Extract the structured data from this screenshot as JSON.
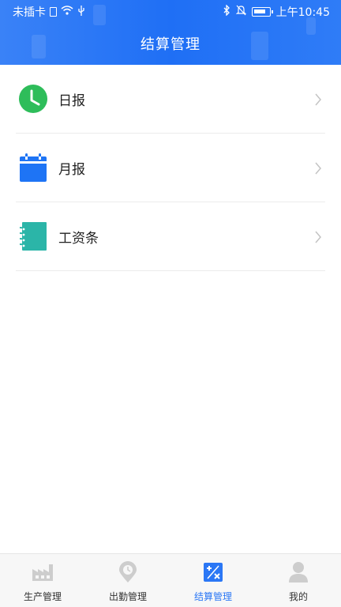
{
  "status_bar": {
    "carrier": "未插卡",
    "time": "上午10:45"
  },
  "header": {
    "title": "结算管理"
  },
  "colors": {
    "header_blue": "#2a78f6",
    "accent": "#2b77f5",
    "daily_icon": "#2ebd5a",
    "monthly_icon": "#1e74f5",
    "payslip_icon": "#2bb5a8"
  },
  "list": {
    "items": [
      {
        "label": "日报",
        "icon": "clock-icon"
      },
      {
        "label": "月报",
        "icon": "calendar-icon"
      },
      {
        "label": "工资条",
        "icon": "notebook-icon"
      }
    ]
  },
  "tabbar": {
    "tabs": [
      {
        "label": "生产管理",
        "icon": "factory-icon",
        "active": false
      },
      {
        "label": "出勤管理",
        "icon": "location-pin-icon",
        "active": false
      },
      {
        "label": "结算管理",
        "icon": "calculator-icon",
        "active": true
      },
      {
        "label": "我的",
        "icon": "person-icon",
        "active": false
      }
    ]
  }
}
